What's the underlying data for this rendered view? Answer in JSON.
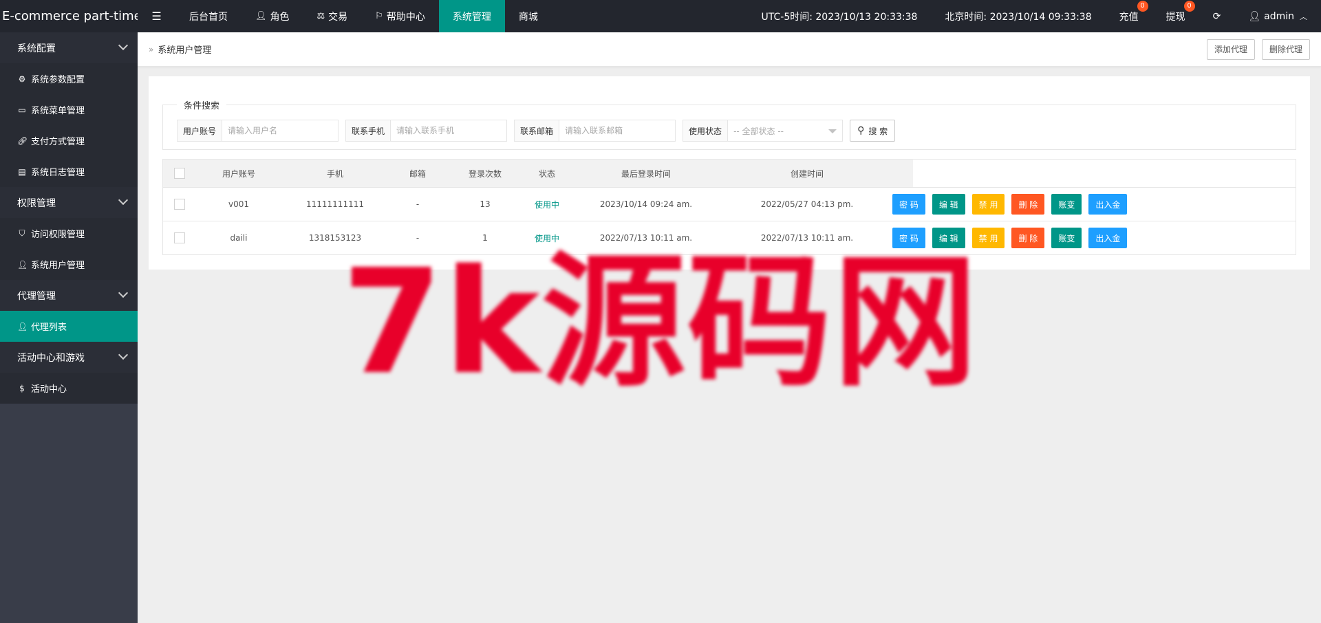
{
  "brand": "E-commerce part-time",
  "nav": [
    {
      "label": "后台首页",
      "icon": ""
    },
    {
      "label": "角色",
      "icon": "user-icon"
    },
    {
      "label": "交易",
      "icon": "scale-icon"
    },
    {
      "label": "帮助中心",
      "icon": "flag-icon"
    },
    {
      "label": "系统管理",
      "icon": "",
      "active": true
    },
    {
      "label": "商城",
      "icon": ""
    }
  ],
  "topright": {
    "utc_time": "UTC-5时间: 2023/10/13 20:33:38",
    "beijing_time": "北京时间: 2023/10/14 09:33:38",
    "recharge": "充值",
    "recharge_badge": "0",
    "withdraw": "提现",
    "withdraw_badge": "0",
    "user": "admin"
  },
  "sidebar": {
    "groups": [
      {
        "label": "系统配置",
        "items": [
          {
            "label": "系统参数配置",
            "icon": "gear-icon"
          },
          {
            "label": "系统菜单管理",
            "icon": "window-icon"
          },
          {
            "label": "支付方式管理",
            "icon": "link-icon"
          },
          {
            "label": "系统日志管理",
            "icon": "log-icon"
          }
        ]
      },
      {
        "label": "权限管理",
        "items": [
          {
            "label": "访问权限管理",
            "icon": "shield-icon"
          },
          {
            "label": "系统用户管理",
            "icon": "user-icon"
          }
        ]
      },
      {
        "label": "代理管理",
        "items": [
          {
            "label": "代理列表",
            "icon": "user-icon",
            "active": true
          }
        ]
      },
      {
        "label": "活动中心和游戏",
        "items": [
          {
            "label": "活动中心",
            "icon": "dollar-icon"
          }
        ]
      }
    ]
  },
  "breadcrumb": {
    "title": "系统用户管理",
    "add_btn": "添加代理",
    "del_btn": "删除代理"
  },
  "search": {
    "legend": "条件搜索",
    "account_label": "用户账号",
    "account_placeholder": "请输入用户名",
    "phone_label": "联系手机",
    "phone_placeholder": "请输入联系手机",
    "mail_label": "联系邮箱",
    "mail_placeholder": "请输入联系邮箱",
    "status_label": "使用状态",
    "status_value": "-- 全部状态 --",
    "search_btn": "搜 索"
  },
  "table": {
    "headers": [
      "用户账号",
      "手机",
      "邮箱",
      "登录次数",
      "状态",
      "最后登录时间",
      "创建时间"
    ],
    "rows": [
      {
        "account": "v001",
        "phone": "11111111111",
        "mail": "-",
        "logins": "13",
        "status": "使用中",
        "last_login": "2023/10/14 09:24 am.",
        "created": "2022/05/27 04:13 pm."
      },
      {
        "account": "daili",
        "phone": "1318153123",
        "mail": "-",
        "logins": "1",
        "status": "使用中",
        "last_login": "2022/07/13 10:11 am.",
        "created": "2022/07/13 10:11 am."
      }
    ],
    "ops": [
      "密 码",
      "编 辑",
      "禁 用",
      "删 除",
      "账变",
      "出入金"
    ]
  },
  "watermark": "7k源码网",
  "colors": {
    "topbar": "#23262e",
    "sidebar": "#393d49",
    "accent": "#009688",
    "blue": "#1e9fff",
    "yellow": "#ffb800",
    "red": "#ff5722",
    "watermark": "#e8002a"
  }
}
